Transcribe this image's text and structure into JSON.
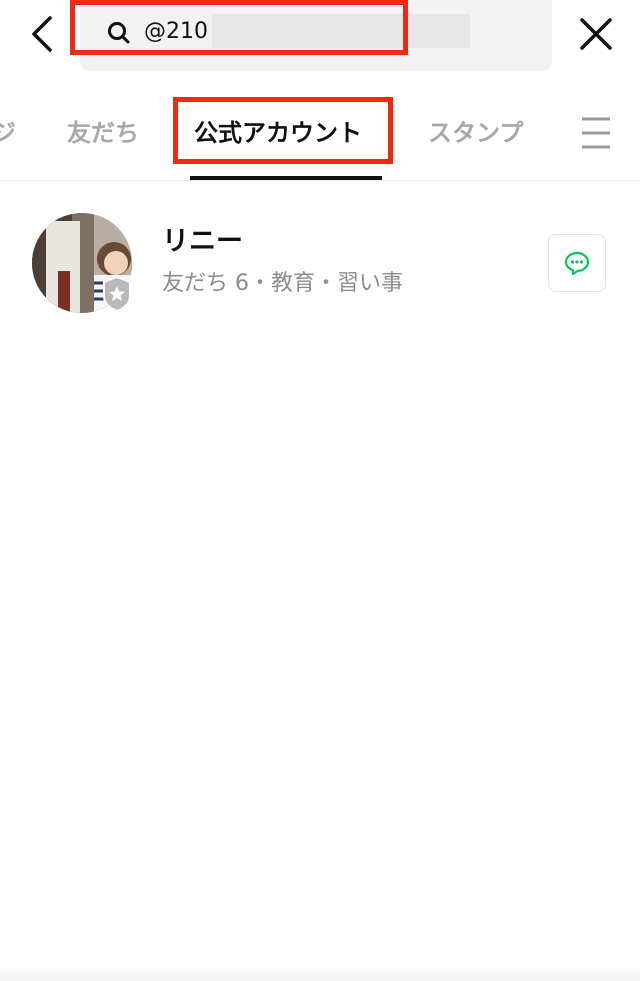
{
  "search": {
    "query": "@210"
  },
  "tabs": [
    {
      "label": "ジ",
      "active": false
    },
    {
      "label": "友だち",
      "active": false
    },
    {
      "label": "公式アカウント",
      "active": true
    },
    {
      "label": "スタンプ",
      "active": false
    }
  ],
  "results": [
    {
      "name": "リニー",
      "subtitle": "友だち 6・教育・習い事",
      "badge_icon": "official-star-shield-icon",
      "action_icon": "chat-icon"
    }
  ],
  "colors": {
    "highlight_border": "#f02a12",
    "chat_icon": "#06c755",
    "inactive_tab": "#a8a8a8",
    "badge": "#b9b9b9"
  }
}
